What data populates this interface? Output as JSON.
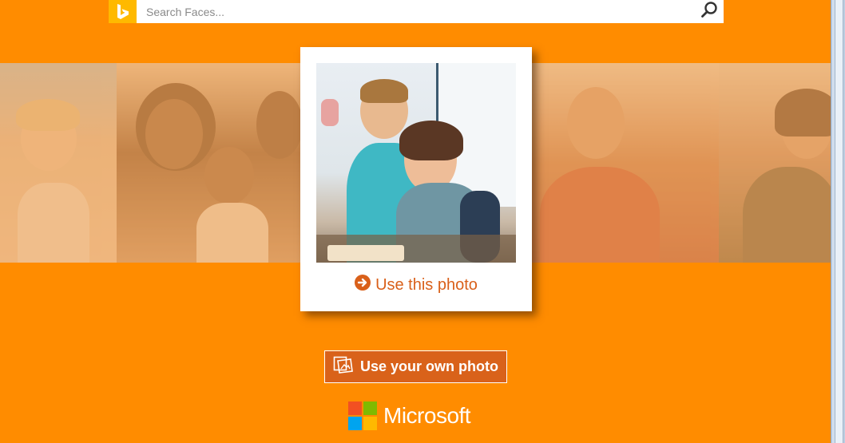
{
  "search": {
    "placeholder": "Search Faces..."
  },
  "featured": {
    "action_label": "Use this photo"
  },
  "upload": {
    "label": "Use your own photo"
  },
  "brand": {
    "name": "Microsoft",
    "logo_colors": [
      "#F25022",
      "#7FBA00",
      "#00A4EF",
      "#FFB900"
    ]
  },
  "colors": {
    "background": "#FF8C00",
    "accent": "#D9601A",
    "bing": "#FFB900"
  }
}
